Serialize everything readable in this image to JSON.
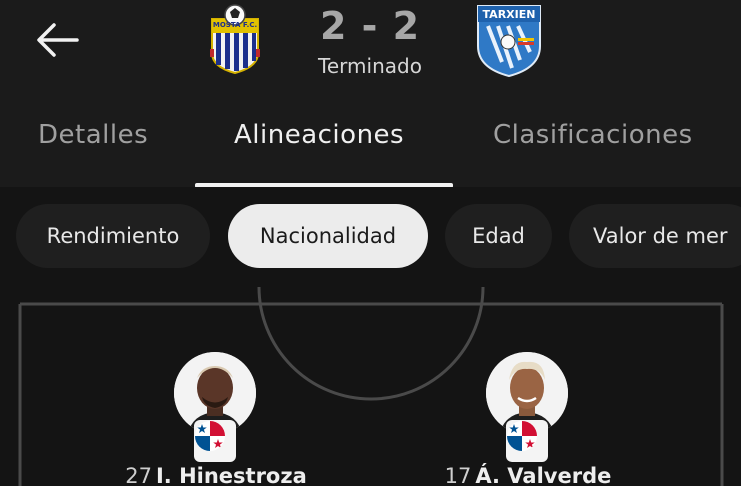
{
  "header": {
    "back_icon": "arrow-left-icon",
    "home_team": {
      "crest_icon": "mosta-fc-crest-icon",
      "crest_text": "MOSTA F.C."
    },
    "away_team": {
      "crest_icon": "tarxien-crest-icon",
      "crest_text": "TARXIEN"
    },
    "score": "2 - 2",
    "status": "Terminado"
  },
  "tabs": [
    {
      "label": "Detalles",
      "active": false
    },
    {
      "label": "Alineaciones",
      "active": true
    },
    {
      "label": "Clasificaciones",
      "active": false
    }
  ],
  "filters": [
    {
      "label": "Rendimiento",
      "active": false
    },
    {
      "label": "Nacionalidad",
      "active": true
    },
    {
      "label": "Edad",
      "active": false
    },
    {
      "label": "Valor de mer",
      "active": false
    }
  ],
  "players": [
    {
      "number": "27",
      "name": "I. Hinestroza",
      "flag_icon": "panama-flag-icon"
    },
    {
      "number": "17",
      "name": "Á. Valverde",
      "flag_icon": "panama-flag-icon"
    }
  ],
  "colors": {
    "background": "#141414",
    "header_bg": "#1b1b1b",
    "chip_bg": "#1f1f1f",
    "chip_active_bg": "#ececec",
    "pitch_line": "#4a4a4a"
  }
}
